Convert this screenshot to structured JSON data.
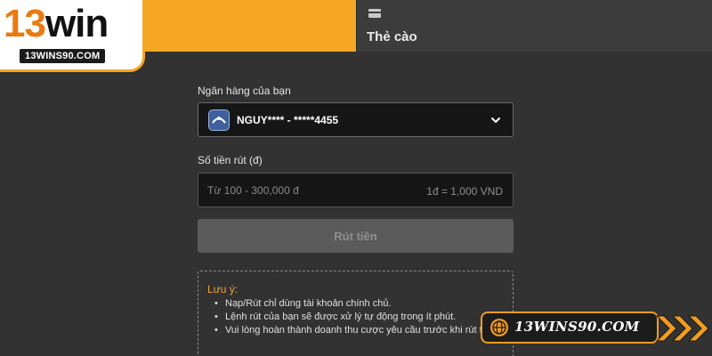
{
  "logo": {
    "number": "13",
    "word": "win",
    "domain": "13WINS90.COM"
  },
  "tabs": {
    "card_tab_label": "Thẻ cào"
  },
  "form": {
    "bank_label": "Ngân hàng của bạn",
    "bank_value": "NGUY**** - *****4455",
    "amount_label": "Số tiền rút (đ)",
    "amount_placeholder": "Từ 100 - 300,000 đ",
    "rate_text": "1đ = 1,000 VND",
    "submit_label": "Rút tiền"
  },
  "note": {
    "title": "Lưu ý:",
    "items": [
      "Nạp/Rút chỉ dùng tài khoản chính chủ.",
      "Lệnh rút của bạn sẽ được xử lý tự động trong ít phút.",
      "Vui lòng hoàn thành doanh thu cược yêu cầu trước khi rút tiền."
    ]
  },
  "banner": {
    "text": "13WINS90.COM"
  },
  "colors": {
    "accent": "#f5a623",
    "background": "#323232",
    "note_title": "#f0a33a"
  },
  "icons": {
    "card_tab": "card-icon",
    "bank": "bank-logo-icon",
    "dropdown": "chevron-down-icon",
    "banner": "globe-icon"
  }
}
